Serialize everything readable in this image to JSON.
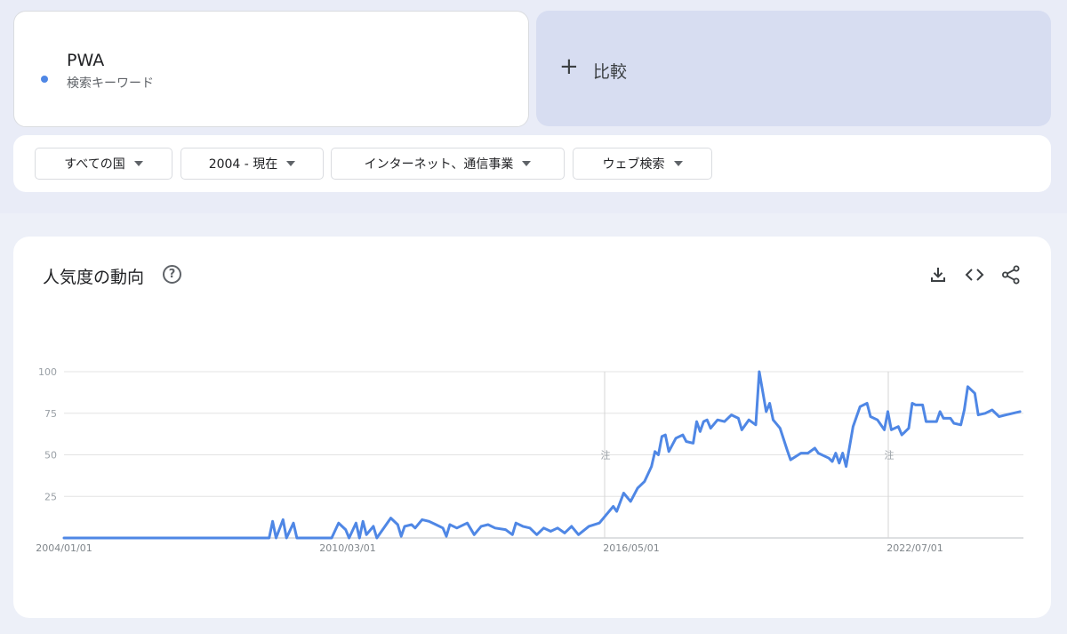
{
  "search_term": {
    "name": "PWA",
    "type": "検索キーワード",
    "color": "#4f87e5"
  },
  "compare": {
    "plus": "+",
    "label": "比較"
  },
  "filters": [
    {
      "label": "すべての国"
    },
    {
      "label": "2004 - 現在"
    },
    {
      "label": "インターネット、通信事業"
    },
    {
      "label": "ウェブ検索"
    }
  ],
  "chart": {
    "title": "人気度の動向",
    "help": "?",
    "tools": [
      "download-icon",
      "embed-icon",
      "share-icon"
    ]
  },
  "chart_data": {
    "type": "line",
    "ylim": [
      0,
      100
    ],
    "y_ticks": [
      25,
      50,
      75,
      100
    ],
    "x_tick_labels": [
      "2004/01/01",
      "2010/03/01",
      "2016/05/01",
      "2022/07/01"
    ],
    "annotations": [
      "注",
      "注"
    ],
    "grid": true,
    "legend": "none",
    "series": [
      {
        "color": "#4f87e5",
        "points": [
          [
            "2004-01",
            0
          ],
          [
            "2008-12",
            0
          ],
          [
            "2009-01",
            10
          ],
          [
            "2009-02",
            0
          ],
          [
            "2009-04",
            11
          ],
          [
            "2009-05",
            0
          ],
          [
            "2009-07",
            9
          ],
          [
            "2009-08",
            0
          ],
          [
            "2010-06",
            0
          ],
          [
            "2010-08",
            9
          ],
          [
            "2010-10",
            5
          ],
          [
            "2010-11",
            0
          ],
          [
            "2011-01",
            9
          ],
          [
            "2011-02",
            0
          ],
          [
            "2011-03",
            10
          ],
          [
            "2011-04",
            2
          ],
          [
            "2011-06",
            7
          ],
          [
            "2011-07",
            0
          ],
          [
            "2011-09",
            6
          ],
          [
            "2011-11",
            12
          ],
          [
            "2012-01",
            8
          ],
          [
            "2012-02",
            1
          ],
          [
            "2012-03",
            7
          ],
          [
            "2012-05",
            8
          ],
          [
            "2012-06",
            6
          ],
          [
            "2012-08",
            11
          ],
          [
            "2012-10",
            10
          ],
          [
            "2012-12",
            8
          ],
          [
            "2013-02",
            6
          ],
          [
            "2013-03",
            1
          ],
          [
            "2013-04",
            8
          ],
          [
            "2013-06",
            6
          ],
          [
            "2013-09",
            9
          ],
          [
            "2013-11",
            2
          ],
          [
            "2014-01",
            7
          ],
          [
            "2014-03",
            8
          ],
          [
            "2014-05",
            6
          ],
          [
            "2014-08",
            5
          ],
          [
            "2014-10",
            2
          ],
          [
            "2014-11",
            9
          ],
          [
            "2015-01",
            7
          ],
          [
            "2015-03",
            6
          ],
          [
            "2015-05",
            2
          ],
          [
            "2015-07",
            6
          ],
          [
            "2015-09",
            4
          ],
          [
            "2015-11",
            6
          ],
          [
            "2016-01",
            3
          ],
          [
            "2016-03",
            7
          ],
          [
            "2016-05",
            2
          ],
          [
            "2016-08",
            7
          ],
          [
            "2016-11",
            9
          ],
          [
            "2017-01",
            14
          ],
          [
            "2017-03",
            19
          ],
          [
            "2017-04",
            16
          ],
          [
            "2017-06",
            27
          ],
          [
            "2017-08",
            22
          ],
          [
            "2017-10",
            30
          ],
          [
            "2017-12",
            34
          ],
          [
            "2018-02",
            43
          ],
          [
            "2018-03",
            52
          ],
          [
            "2018-04",
            50
          ],
          [
            "2018-05",
            61
          ],
          [
            "2018-06",
            62
          ],
          [
            "2018-07",
            52
          ],
          [
            "2018-09",
            60
          ],
          [
            "2018-11",
            62
          ],
          [
            "2018-12",
            58
          ],
          [
            "2019-02",
            57
          ],
          [
            "2019-03",
            70
          ],
          [
            "2019-04",
            64
          ],
          [
            "2019-05",
            70
          ],
          [
            "2019-06",
            71
          ],
          [
            "2019-07",
            66
          ],
          [
            "2019-09",
            71
          ],
          [
            "2019-11",
            70
          ],
          [
            "2020-01",
            74
          ],
          [
            "2020-03",
            72
          ],
          [
            "2020-04",
            65
          ],
          [
            "2020-06",
            71
          ],
          [
            "2020-08",
            68
          ],
          [
            "2020-09",
            100
          ],
          [
            "2020-11",
            76
          ],
          [
            "2020-12",
            81
          ],
          [
            "2021-01",
            71
          ],
          [
            "2021-03",
            66
          ],
          [
            "2021-05",
            53
          ],
          [
            "2021-06",
            47
          ],
          [
            "2021-09",
            51
          ],
          [
            "2021-11",
            51
          ],
          [
            "2022-01",
            54
          ],
          [
            "2022-02",
            51
          ],
          [
            "2022-05",
            48
          ],
          [
            "2022-06",
            46
          ],
          [
            "2022-07",
            51
          ],
          [
            "2022-08",
            45
          ],
          [
            "2022-09",
            51
          ],
          [
            "2022-10",
            43
          ],
          [
            "2022-12",
            67
          ],
          [
            "2023-02",
            79
          ],
          [
            "2023-04",
            81
          ],
          [
            "2023-05",
            73
          ],
          [
            "2023-07",
            71
          ],
          [
            "2023-09",
            65
          ],
          [
            "2023-10",
            76
          ],
          [
            "2023-11",
            65
          ],
          [
            "2024-01",
            67
          ],
          [
            "2024-02",
            62
          ],
          [
            "2024-04",
            66
          ],
          [
            "2024-05",
            81
          ],
          [
            "2024-06",
            80
          ],
          [
            "2024-08",
            80
          ],
          [
            "2024-09",
            70
          ],
          [
            "2024-12",
            70
          ],
          [
            "2025-01",
            76
          ],
          [
            "2025-02",
            72
          ],
          [
            "2025-04",
            72
          ],
          [
            "2025-05",
            69
          ],
          [
            "2025-07",
            68
          ],
          [
            "2025-08",
            77
          ],
          [
            "2025-09",
            91
          ],
          [
            "2025-11",
            87
          ],
          [
            "2025-12",
            74
          ],
          [
            "2026-02",
            75
          ],
          [
            "2026-04",
            77
          ],
          [
            "2026-06",
            73
          ],
          [
            "2026-08",
            74
          ],
          [
            "2026-12",
            76
          ]
        ]
      }
    ]
  }
}
